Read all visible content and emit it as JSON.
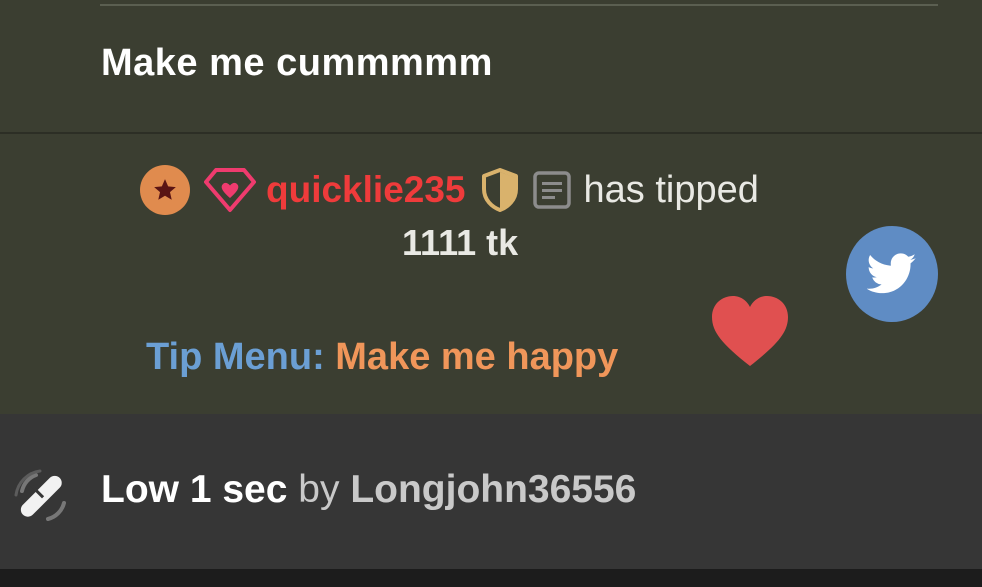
{
  "chat": {
    "message": "Make me cummmmm"
  },
  "tip": {
    "username": "quicklie235",
    "action": "has tipped",
    "amount": "1111 tk",
    "menu_label": "Tip Menu:",
    "menu_item": "Make me happy"
  },
  "vibe": {
    "level": "Low 1 sec",
    "by": "by",
    "user": "Longjohn36556"
  },
  "icons": {
    "star_badge": "star-icon",
    "diamond_badge": "diamond-heart-icon",
    "shield": "shield-icon",
    "note": "note-icon",
    "twitter": "twitter-icon",
    "heart": "heart-icon",
    "vibe": "vibration-icon"
  },
  "colors": {
    "panel_bg": "#3b3e31",
    "username": "#ef3b3b",
    "tip_menu_label": "#6b9fd4",
    "tip_menu_item": "#f0965a",
    "twitter_bg": "#5f8cc4",
    "heart": "#e05050",
    "star_badge": "#e08b4e",
    "shield_gold": "#d9b26c",
    "bottom_panel": "#363636"
  }
}
